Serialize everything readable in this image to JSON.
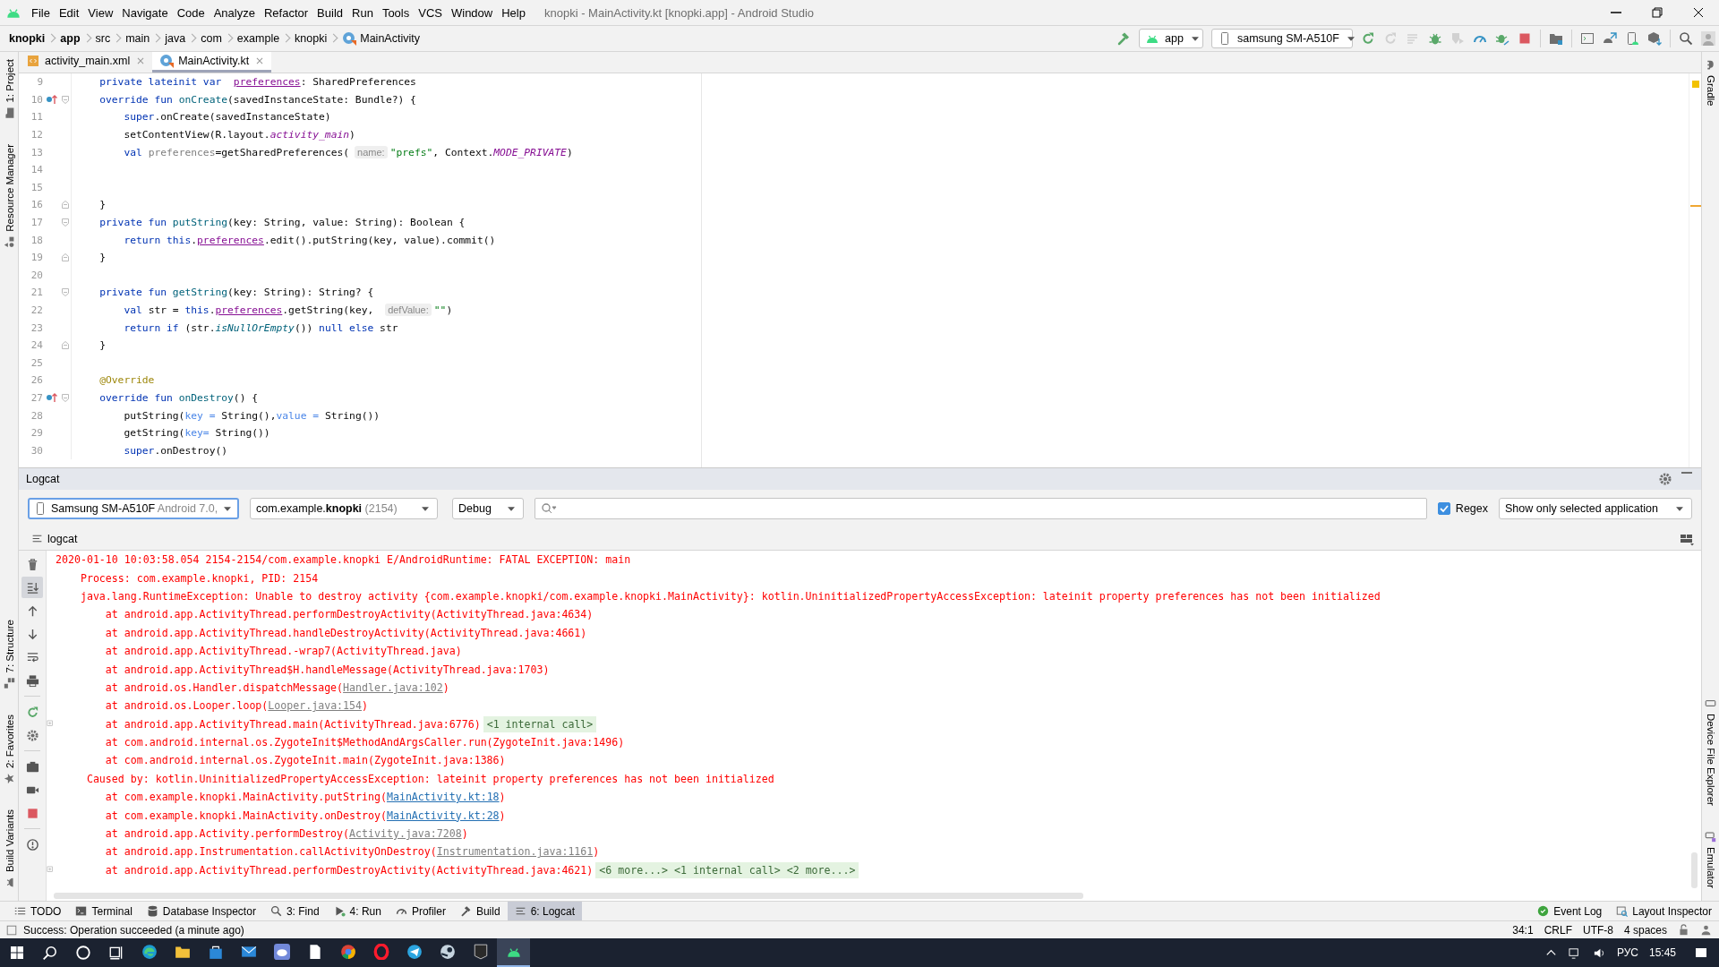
{
  "title_bar": {
    "menu": [
      "File",
      "Edit",
      "View",
      "Navigate",
      "Code",
      "Analyze",
      "Refactor",
      "Build",
      "Run",
      "Tools",
      "VCS",
      "Window",
      "Help"
    ],
    "title": "knopki - MainActivity.kt [knopki.app] - Android Studio"
  },
  "breadcrumbs": [
    {
      "label": "knopki",
      "kind": "project"
    },
    {
      "label": "app",
      "kind": "module"
    },
    {
      "label": "src",
      "kind": "folder"
    },
    {
      "label": "main",
      "kind": "folder"
    },
    {
      "label": "java",
      "kind": "folder"
    },
    {
      "label": "com",
      "kind": "folder"
    },
    {
      "label": "example",
      "kind": "folder"
    },
    {
      "label": "knopki",
      "kind": "folder"
    },
    {
      "label": "MainActivity",
      "kind": "class"
    }
  ],
  "toolbar": {
    "run_config": "app",
    "device": "samsung SM-A510F",
    "actions": [
      {
        "kind": "rerun",
        "disabled": false
      },
      {
        "kind": "apply-changes",
        "disabled": true
      },
      {
        "kind": "apply-code",
        "disabled": true
      },
      {
        "kind": "debug",
        "disabled": false
      },
      {
        "kind": "attach",
        "disabled": true
      },
      {
        "kind": "profile",
        "disabled": false
      },
      {
        "kind": "attach-debugger",
        "disabled": false
      },
      {
        "kind": "stop",
        "disabled": false
      },
      {
        "kind": "project-structure",
        "disabled": false
      },
      {
        "kind": "window",
        "disabled": false
      },
      {
        "kind": "avd",
        "disabled": false
      },
      {
        "kind": "device-manager",
        "disabled": false
      },
      {
        "kind": "sdk",
        "disabled": false
      },
      {
        "kind": "search",
        "disabled": false
      },
      {
        "kind": "avatar",
        "disabled": false
      }
    ]
  },
  "left_tool_windows": {
    "top": [
      {
        "label": "1: Project",
        "kind": "folder"
      },
      {
        "label": "Resource Manager",
        "kind": "resources"
      }
    ],
    "bottom": [
      {
        "label": "7: Structure",
        "kind": "structure"
      },
      {
        "label": "2: Favorites",
        "kind": "favorites"
      },
      {
        "label": "Build Variants",
        "kind": "variants"
      }
    ]
  },
  "right_tool_windows": {
    "top": [
      {
        "label": "Gradle",
        "kind": "gradle"
      }
    ],
    "bottom": [
      {
        "label": "Device File Explorer",
        "kind": "device"
      },
      {
        "label": "Emulator",
        "kind": "emulator"
      }
    ]
  },
  "editor_tabs": [
    {
      "label": "activity_main.xml",
      "kind": "xml",
      "selected": false
    },
    {
      "label": "MainActivity.kt",
      "kind": "kotlin",
      "selected": true
    }
  ],
  "code_lines": [
    {
      "number": "9",
      "override": false,
      "fold_open": false,
      "fold_close": false,
      "segments": [
        {
          "kind": "keyword",
          "text": "    private lateinit var  "
        },
        {
          "kind": "property",
          "text": "preferences"
        },
        {
          "kind": "plain",
          "text": ": SharedPreferences"
        }
      ]
    },
    {
      "number": "10",
      "override": true,
      "fold_open": true,
      "fold_close": false,
      "segments": [
        {
          "kind": "keyword",
          "text": "    override fun "
        },
        {
          "kind": "declaration",
          "text": "onCreate"
        },
        {
          "kind": "plain",
          "text": "(savedInstanceState: Bundle?) {"
        }
      ]
    },
    {
      "number": "11",
      "override": false,
      "fold_open": false,
      "fold_close": false,
      "segments": [
        {
          "kind": "keyword",
          "text": "        super"
        },
        {
          "kind": "plain",
          "text": ".onCreate(savedInstanceState)"
        }
      ]
    },
    {
      "number": "12",
      "override": false,
      "fold_open": false,
      "fold_close": false,
      "segments": [
        {
          "kind": "plain",
          "text": "        setContentView(R.layout."
        },
        {
          "kind": "static",
          "text": "activity_main"
        },
        {
          "kind": "plain",
          "text": ")"
        }
      ]
    },
    {
      "number": "13",
      "override": false,
      "fold_open": false,
      "fold_close": false,
      "segments": [
        {
          "kind": "keyword",
          "text": "        val "
        },
        {
          "kind": "unused",
          "text": "preferences"
        },
        {
          "kind": "plain",
          "text": "=getSharedPreferences("
        },
        {
          "kind": "hint",
          "text": "name:"
        },
        {
          "kind": "string",
          "text": "\"prefs\""
        },
        {
          "kind": "plain",
          "text": ", Context."
        },
        {
          "kind": "static",
          "text": "MODE_PRIVATE"
        },
        {
          "kind": "plain",
          "text": ")"
        }
      ]
    },
    {
      "number": "14",
      "override": false,
      "fold_open": false,
      "fold_close": false
    },
    {
      "number": "15",
      "override": false,
      "fold_open": false,
      "fold_close": false
    },
    {
      "number": "16",
      "override": false,
      "fold_open": false,
      "fold_close": true,
      "segments": [
        {
          "kind": "plain",
          "text": "    }"
        }
      ]
    },
    {
      "number": "17",
      "override": false,
      "fold_open": true,
      "fold_close": false,
      "segments": [
        {
          "kind": "keyword",
          "text": "    private fun "
        },
        {
          "kind": "declaration",
          "text": "putString"
        },
        {
          "kind": "plain",
          "text": "(key: String, value: String): Boolean {"
        }
      ]
    },
    {
      "number": "18",
      "override": false,
      "fold_open": false,
      "fold_close": false,
      "segments": [
        {
          "kind": "keyword",
          "text": "        return this"
        },
        {
          "kind": "plain",
          "text": "."
        },
        {
          "kind": "property",
          "text": "preferences"
        },
        {
          "kind": "plain",
          "text": ".edit().putString(key, value).commit()"
        }
      ]
    },
    {
      "number": "19",
      "override": false,
      "fold_open": false,
      "fold_close": true,
      "segments": [
        {
          "kind": "plain",
          "text": "    }"
        }
      ]
    },
    {
      "number": "20",
      "override": false,
      "fold_open": false,
      "fold_close": false
    },
    {
      "number": "21",
      "override": false,
      "fold_open": true,
      "fold_close": false,
      "segments": [
        {
          "kind": "keyword",
          "text": "    private fun "
        },
        {
          "kind": "declaration",
          "text": "getString"
        },
        {
          "kind": "plain",
          "text": "(key: String): String? {"
        }
      ]
    },
    {
      "number": "22",
      "override": false,
      "fold_open": false,
      "fold_close": false,
      "segments": [
        {
          "kind": "keyword",
          "text": "        val "
        },
        {
          "kind": "plain",
          "text": "str = "
        },
        {
          "kind": "keyword",
          "text": "this"
        },
        {
          "kind": "plain",
          "text": "."
        },
        {
          "kind": "property",
          "text": "preferences"
        },
        {
          "kind": "plain",
          "text": ".getString(key, "
        },
        {
          "kind": "hint",
          "text": "defValue:"
        },
        {
          "kind": "string",
          "text": "\"\""
        },
        {
          "kind": "plain",
          "text": ")"
        }
      ]
    },
    {
      "number": "23",
      "override": false,
      "fold_open": false,
      "fold_close": false,
      "segments": [
        {
          "kind": "keyword",
          "text": "        return if "
        },
        {
          "kind": "plain",
          "text": "(str."
        },
        {
          "kind": "extension",
          "text": "isNullOrEmpty"
        },
        {
          "kind": "plain",
          "text": "()) "
        },
        {
          "kind": "keyword",
          "text": "null else "
        },
        {
          "kind": "plain",
          "text": "str"
        }
      ]
    },
    {
      "number": "24",
      "override": false,
      "fold_open": false,
      "fold_close": true,
      "segments": [
        {
          "kind": "plain",
          "text": "    }"
        }
      ]
    },
    {
      "number": "25",
      "override": false,
      "fold_open": false,
      "fold_close": false
    },
    {
      "number": "26",
      "override": false,
      "fold_open": false,
      "fold_close": false,
      "segments": [
        {
          "kind": "annotation",
          "text": "    @Override"
        }
      ]
    },
    {
      "number": "27",
      "override": true,
      "fold_open": true,
      "fold_close": false,
      "segments": [
        {
          "kind": "keyword",
          "text": "    override fun "
        },
        {
          "kind": "declaration",
          "text": "onDestroy"
        },
        {
          "kind": "plain",
          "text": "() {"
        }
      ]
    },
    {
      "number": "28",
      "override": false,
      "fold_open": false,
      "fold_close": false,
      "segments": [
        {
          "kind": "plain",
          "text": "        putString("
        },
        {
          "kind": "named",
          "text": "key ="
        },
        {
          "kind": "plain",
          "text": " String(),"
        },
        {
          "kind": "named",
          "text": "value ="
        },
        {
          "kind": "plain",
          "text": " String())"
        }
      ]
    },
    {
      "number": "29",
      "override": false,
      "fold_open": false,
      "fold_close": false,
      "segments": [
        {
          "kind": "plain",
          "text": "        getString("
        },
        {
          "kind": "named",
          "text": "key="
        },
        {
          "kind": "plain",
          "text": " String())"
        }
      ]
    },
    {
      "number": "30",
      "override": false,
      "fold_open": false,
      "fold_close": false,
      "segments": [
        {
          "kind": "keyword",
          "text": "        super"
        },
        {
          "kind": "plain",
          "text": ".onDestroy()"
        }
      ]
    }
  ],
  "logcat": {
    "title": "Logcat",
    "device_filter": {
      "device": "Samsung SM-A510F",
      "detail": "Android 7.0,"
    },
    "package_filter": {
      "package": "com.example.**knopki**",
      "pid": "(2154)"
    },
    "level": "Debug",
    "regex": {
      "label": "Regex",
      "checked": true
    },
    "scope": "Show only selected application",
    "view_label": "logcat",
    "tools": [
      {
        "kind": "clear",
        "selected": false
      },
      {
        "kind": "scroll-end",
        "selected": true
      },
      {
        "kind": "up",
        "selected": false
      },
      {
        "kind": "down",
        "selected": false
      },
      {
        "kind": "wrap",
        "selected": false
      },
      {
        "kind": "print",
        "selected": false
      },
      {
        "kind": "restart",
        "selected": false
      },
      {
        "kind": "settings",
        "selected": false
      },
      {
        "kind": "screenshot",
        "selected": false
      },
      {
        "kind": "record",
        "selected": false
      },
      {
        "kind": "stop",
        "selected": false
      },
      {
        "kind": "help",
        "selected": false
      }
    ],
    "lines": [
      {
        "expandable": false,
        "segments": [
          {
            "kind": "text",
            "text": "2020-01-10 10:03:58.054 2154-2154/com.example.knopki E/AndroidRuntime: FATAL EXCEPTION: main"
          }
        ]
      },
      {
        "expandable": false,
        "segments": [
          {
            "kind": "text",
            "text": "    Process: com.example.knopki, PID: 2154"
          }
        ]
      },
      {
        "expandable": false,
        "segments": [
          {
            "kind": "text",
            "text": "    java.lang.RuntimeException: Unable to destroy activity {com.example.knopki/com.example.knopki.MainActivity}: kotlin.UninitializedPropertyAccessException: lateinit property preferences has not been initialized"
          }
        ]
      },
      {
        "expandable": false,
        "segments": [
          {
            "kind": "text",
            "text": "        at android.app.ActivityThread.performDestroyActivity(ActivityThread.java:4634)"
          }
        ]
      },
      {
        "expandable": false,
        "segments": [
          {
            "kind": "text",
            "text": "        at android.app.ActivityThread.handleDestroyActivity(ActivityThread.java:4661)"
          }
        ]
      },
      {
        "expandable": false,
        "segments": [
          {
            "kind": "text",
            "text": "        at android.app.ActivityThread.-wrap7(ActivityThread.java)"
          }
        ]
      },
      {
        "expandable": false,
        "segments": [
          {
            "kind": "text",
            "text": "        at android.app.ActivityThread$H.handleMessage(ActivityThread.java:1703)"
          }
        ]
      },
      {
        "expandable": false,
        "segments": [
          {
            "kind": "text",
            "text": "        at android.os.Handler.dispatchMessage("
          },
          {
            "kind": "lib-link",
            "text": "Handler.java:102"
          },
          {
            "kind": "text",
            "text": ")"
          }
        ]
      },
      {
        "expandable": false,
        "segments": [
          {
            "kind": "text",
            "text": "        at android.os.Looper.loop("
          },
          {
            "kind": "lib-link",
            "text": "Looper.java:154"
          },
          {
            "kind": "text",
            "text": ")"
          }
        ]
      },
      {
        "expandable": true,
        "segments": [
          {
            "kind": "text",
            "text": "        at android.app.ActivityThread.main(ActivityThread.java:6776)"
          },
          {
            "kind": "folded",
            "text": "<1 internal call>"
          }
        ]
      },
      {
        "expandable": false,
        "segments": [
          {
            "kind": "text",
            "text": "        at com.android.internal.os.ZygoteInit$MethodAndArgsCaller.run(ZygoteInit.java:1496)"
          }
        ]
      },
      {
        "expandable": false,
        "segments": [
          {
            "kind": "text",
            "text": "        at com.android.internal.os.ZygoteInit.main(ZygoteInit.java:1386)"
          }
        ]
      },
      {
        "expandable": false,
        "segments": [
          {
            "kind": "text",
            "text": "     Caused by: kotlin.UninitializedPropertyAccessException: lateinit property preferences has not been initialized"
          }
        ]
      },
      {
        "expandable": false,
        "segments": [
          {
            "kind": "text",
            "text": "        at com.example.knopki.MainActivity.putString("
          },
          {
            "kind": "link",
            "text": "MainActivity.kt:18"
          },
          {
            "kind": "text",
            "text": ")"
          }
        ]
      },
      {
        "expandable": false,
        "segments": [
          {
            "kind": "text",
            "text": "        at com.example.knopki.MainActivity.onDestroy("
          },
          {
            "kind": "link",
            "text": "MainActivity.kt:28"
          },
          {
            "kind": "text",
            "text": ")"
          }
        ]
      },
      {
        "expandable": false,
        "segments": [
          {
            "kind": "text",
            "text": "        at android.app.Activity.performDestroy("
          },
          {
            "kind": "lib-link",
            "text": "Activity.java:7208"
          },
          {
            "kind": "text",
            "text": ")"
          }
        ]
      },
      {
        "expandable": false,
        "segments": [
          {
            "kind": "text",
            "text": "        at android.app.Instrumentation.callActivityOnDestroy("
          },
          {
            "kind": "lib-link",
            "text": "Instrumentation.java:1161"
          },
          {
            "kind": "text",
            "text": ")"
          }
        ]
      },
      {
        "expandable": true,
        "segments": [
          {
            "kind": "text",
            "text": "        at android.app.ActivityThread.performDestroyActivity(ActivityThread.java:4621)"
          },
          {
            "kind": "folded",
            "text": "<6 more...> <1 internal call> <2 more...>"
          }
        ]
      }
    ]
  },
  "bottom_tools": [
    {
      "label": "TODO",
      "kind": "todo",
      "selected": false
    },
    {
      "label": "Terminal",
      "kind": "terminal",
      "selected": false
    },
    {
      "label": "Database Inspector",
      "kind": "database",
      "selected": false
    },
    {
      "label": "3: Find",
      "kind": "find",
      "selected": false
    },
    {
      "label": "4: Run",
      "kind": "run",
      "selected": false
    },
    {
      "label": "Profiler",
      "kind": "profiler",
      "selected": false
    },
    {
      "label": "Build",
      "kind": "build",
      "selected": false
    },
    {
      "label": "6: Logcat",
      "kind": "logcat",
      "selected": true
    }
  ],
  "bottom_tools_right": [
    {
      "label": "Event Log",
      "kind": "event-log"
    },
    {
      "label": "Layout Inspector",
      "kind": "layout-inspector"
    }
  ],
  "status_bar": {
    "message": "Success: Operation succeeded (a minute ago)",
    "position": "34:1",
    "line_separator": "CRLF",
    "encoding": "UTF-8",
    "indent": "4 spaces"
  },
  "taskbar": {
    "apps": [
      {
        "kind": "edge",
        "active": false
      },
      {
        "kind": "explorer",
        "active": false
      },
      {
        "kind": "store",
        "active": false
      },
      {
        "kind": "mail",
        "active": false
      },
      {
        "kind": "chat",
        "active": false
      },
      {
        "kind": "document",
        "active": false
      },
      {
        "kind": "chrome",
        "active": false
      },
      {
        "kind": "opera",
        "active": false
      },
      {
        "kind": "messenger",
        "active": false
      },
      {
        "kind": "steam",
        "active": false
      },
      {
        "kind": "launcher",
        "active": false
      },
      {
        "kind": "studio",
        "active": true
      }
    ],
    "language": "РУС",
    "time": "15:45"
  }
}
